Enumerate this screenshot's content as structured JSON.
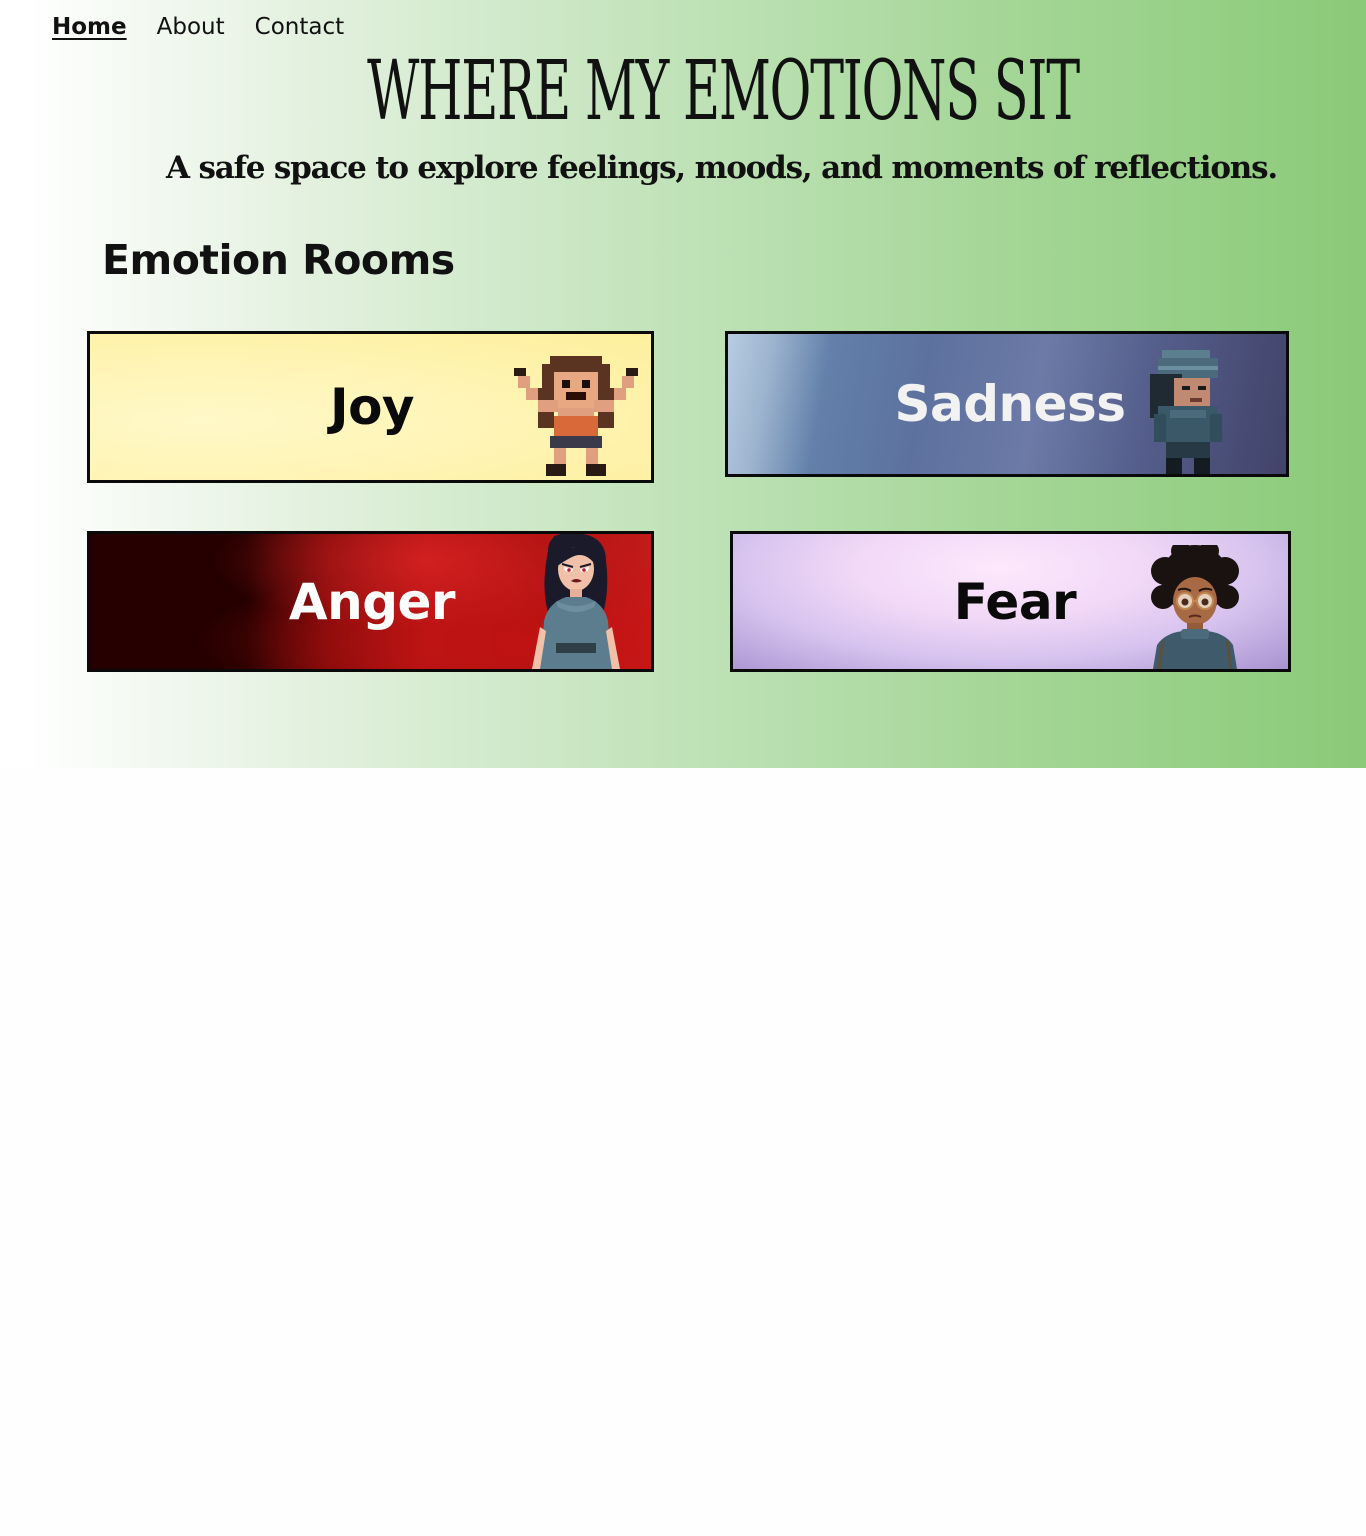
{
  "nav": {
    "items": [
      {
        "label": "Home",
        "active": true
      },
      {
        "label": "About",
        "active": false
      },
      {
        "label": "Contact",
        "active": false
      }
    ]
  },
  "header": {
    "title": "WHERE MY EMOTIONS SIT",
    "subtitle": "A safe space to explore feelings, moods, and moments of reflections."
  },
  "rooms": {
    "heading": "Emotion Rooms",
    "items": [
      {
        "label": "Joy",
        "icon": "joy-character-icon"
      },
      {
        "label": "Sadness",
        "icon": "sadness-character-icon"
      },
      {
        "label": "Anger",
        "icon": "anger-character-icon"
      },
      {
        "label": "Fear",
        "icon": "fear-character-icon"
      }
    ]
  },
  "colors": {
    "gradient_start": "#ffffff",
    "gradient_end": "#8bca78",
    "joy": "#fff5b8",
    "sadness": "#5d719f",
    "anger": "#b31313",
    "fear": "#d6c2ee"
  }
}
